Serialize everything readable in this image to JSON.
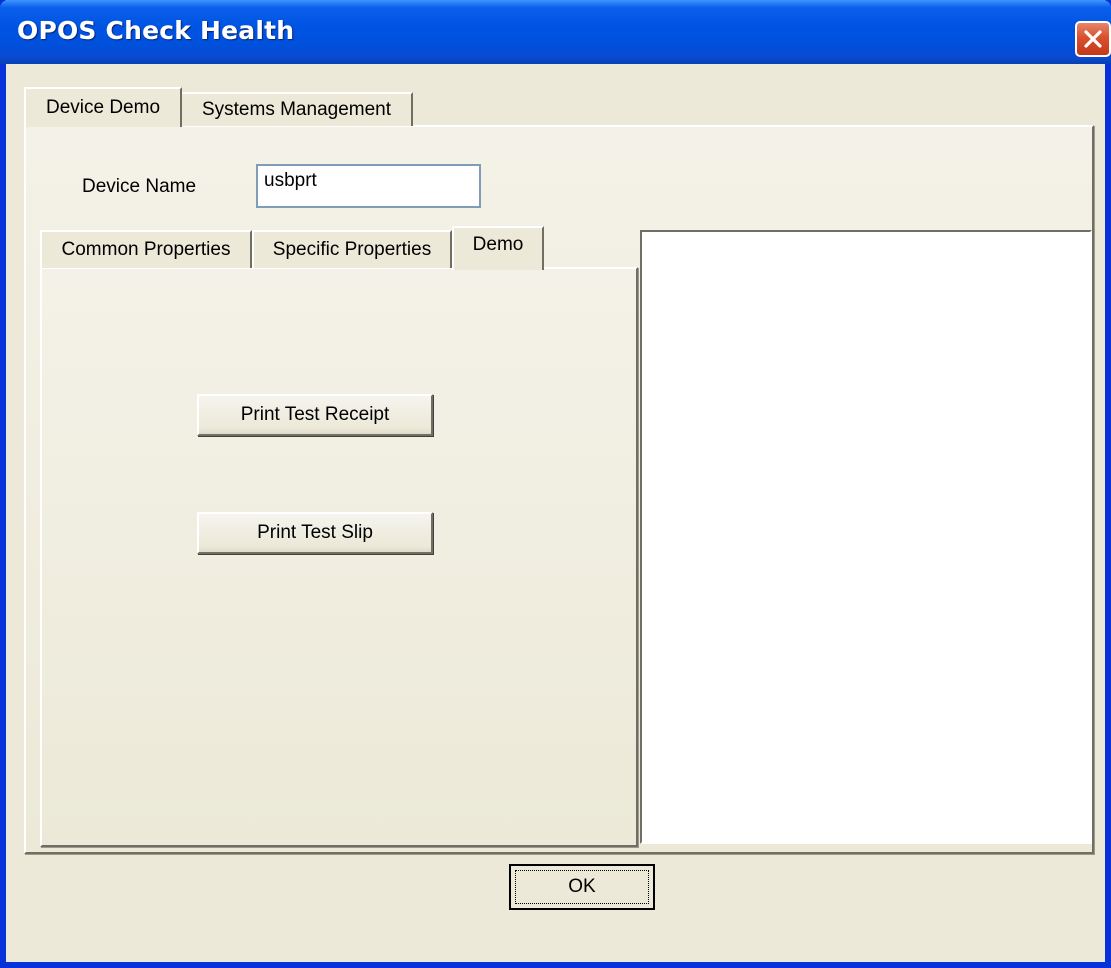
{
  "window": {
    "title": "OPOS Check Health"
  },
  "icons": {
    "close": "close-icon"
  },
  "outer_tabs": [
    {
      "label": "Device Demo",
      "active": true
    },
    {
      "label": "Systems Management",
      "active": false
    }
  ],
  "device": {
    "name_label": "Device Name",
    "name_value": "usbprt"
  },
  "inner_tabs": [
    {
      "label": "Common Properties",
      "active": false
    },
    {
      "label": "Specific Properties",
      "active": false
    },
    {
      "label": "Demo",
      "active": true
    }
  ],
  "demo": {
    "print_receipt_label": "Print Test Receipt",
    "print_slip_label": "Print Test Slip"
  },
  "footer": {
    "ok_label": "OK"
  },
  "colors": {
    "titlebar": "#0054E3",
    "face": "#ECE9D8",
    "close": "#D8512E"
  }
}
